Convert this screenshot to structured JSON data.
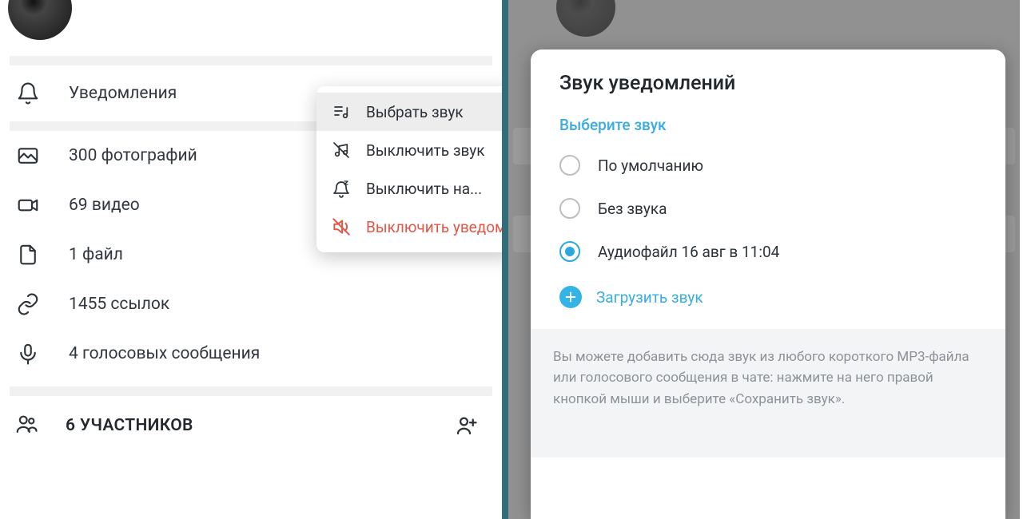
{
  "left": {
    "notifications_label": "Уведомления",
    "media": {
      "photos": "300 фотографий",
      "videos": "69 видео",
      "file": "1 файл",
      "links": "1455 ссылок",
      "voice": "4 голосовых сообщения"
    },
    "members_label": "6 УЧАСТНИКОВ"
  },
  "context_menu": {
    "choose_sound": "Выбрать звук",
    "mute_sound": "Выключить звук",
    "mute_for": "Выключить на...",
    "disable_notifications": "Выключить уведомления"
  },
  "dialog": {
    "title": "Звук уведомлений",
    "subtitle": "Выберите звук",
    "options": {
      "default": "По умолчанию",
      "silent": "Без звука",
      "custom": "Аудиофайл 16 авг в 11:04"
    },
    "upload": "Загрузить звук",
    "hint": "Вы можете добавить сюда звук из любого короткого MP3-файла или голосового сообщения в чате: нажмите на него правой кнопкой мыши и выберите «Сохранить звук»."
  },
  "colors": {
    "accent": "#39ade0",
    "danger": "#e45648"
  }
}
